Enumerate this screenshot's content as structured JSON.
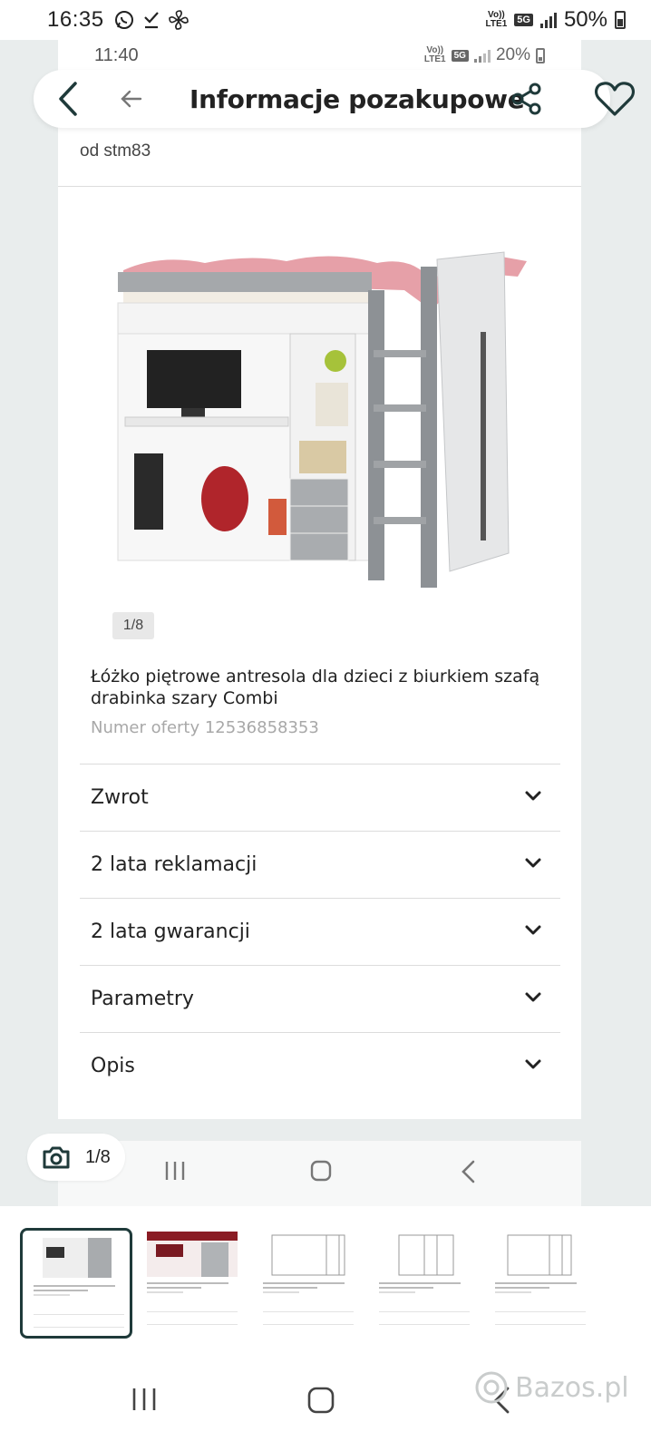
{
  "os_status": {
    "time": "16:35",
    "battery": "50%",
    "net_top": "Vo))",
    "net_bottom": "LTE1",
    "net_5g": "5G"
  },
  "inner_status": {
    "time": "11:40",
    "battery": "20%",
    "net_top": "Vo))",
    "net_bottom": "LTE1",
    "net_5g": "5G"
  },
  "header": {
    "title": "Informacje pozakupowe"
  },
  "seller": {
    "text": "od stm83"
  },
  "image": {
    "counter": "1/8"
  },
  "product": {
    "title": "Łóżko piętrowe antresola dla dzieci z biurkiem szafą drabinka szary Combi",
    "offer_number": "Numer oferty 12536858353"
  },
  "accordion": [
    {
      "label": "Zwrot"
    },
    {
      "label": "2 lata reklamacji"
    },
    {
      "label": "2 lata gwarancji"
    },
    {
      "label": "Parametry"
    },
    {
      "label": "Opis"
    }
  ],
  "photo_pill": {
    "count": "1/8"
  },
  "watermark": {
    "text": "Bazos.pl"
  },
  "colors": {
    "accent_dark": "#1f3a3a",
    "background": "#e9eded",
    "muted": "#a8a8a8"
  }
}
